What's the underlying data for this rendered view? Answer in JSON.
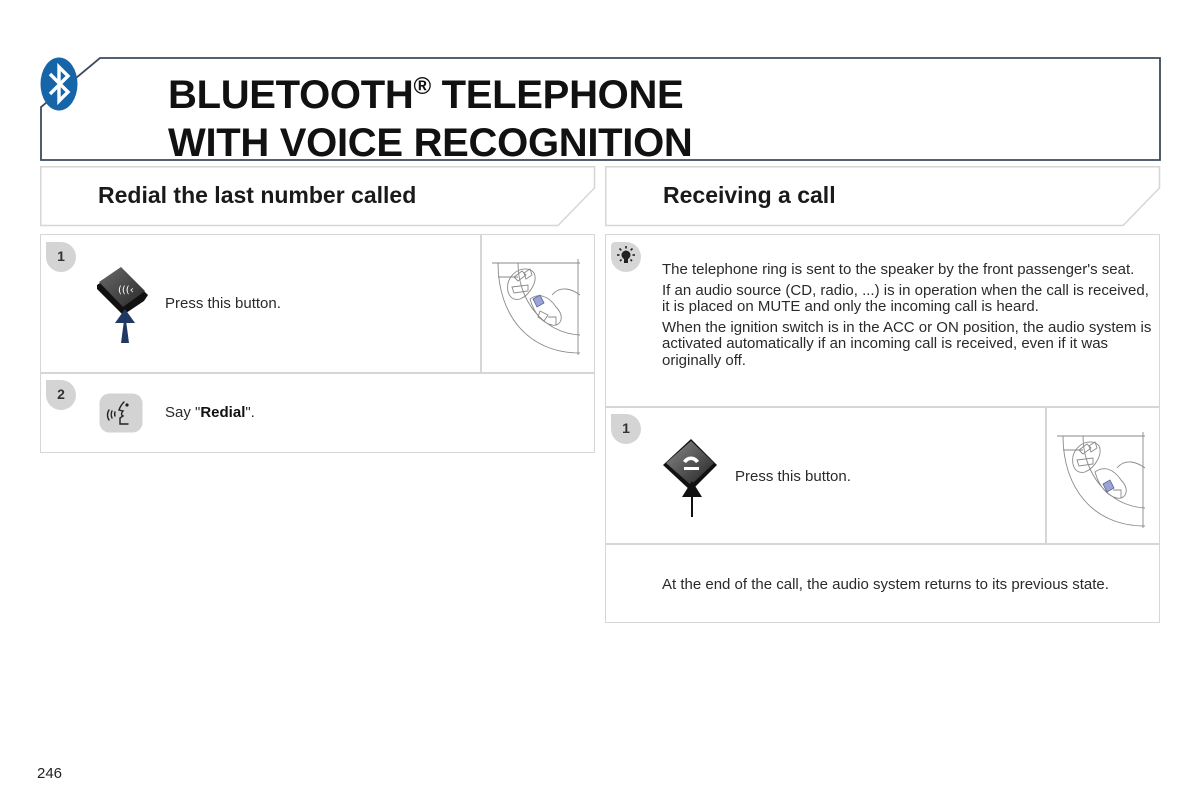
{
  "page": {
    "title_line1_main": "BLUETOOTH",
    "title_line1_reg": "®",
    "title_line1_rest": " TELEPHONE",
    "title_line2": "WITH VOICE RECOGNITION",
    "title_icon": "bluetooth-icon",
    "page_number": "246",
    "colors": {
      "banner_border": "#3d4b5c",
      "bluetooth_blue": "#1565a8",
      "box_border": "#d6d6d6",
      "badge_gray": "#d4d4d4",
      "arrow_navy": "#1f3864"
    }
  },
  "left_section": {
    "heading": "Redial the last number called",
    "steps": [
      {
        "number": "1",
        "icon": "voice-command-button-icon",
        "text": "Press this button.",
        "illustration": "steering-wheel-controls-illustration"
      },
      {
        "number": "2",
        "icon": "voice-speaking-icon",
        "text_prefix": "Say \"",
        "text_bold": "Redial",
        "text_suffix": "\"."
      }
    ]
  },
  "right_section": {
    "heading": "Receiving a call",
    "info": {
      "icon": "tip-lightbulb-icon",
      "paragraphs": [
        "The telephone ring is sent to the speaker by the front passenger's seat.",
        "If an audio source (CD, radio, ...) is in operation when the call is received, it is placed on MUTE and only the incoming call is heard.",
        "When the ignition switch is in the ACC or ON position, the audio system is activated automatically if an incoming call is received, even if it was originally off."
      ]
    },
    "steps": [
      {
        "number": "1",
        "icon": "answer-call-button-icon",
        "text": "Press this button.",
        "illustration": "steering-wheel-controls-illustration"
      }
    ],
    "footer_note": "At the end of the call, the audio system returns to its previous state."
  }
}
